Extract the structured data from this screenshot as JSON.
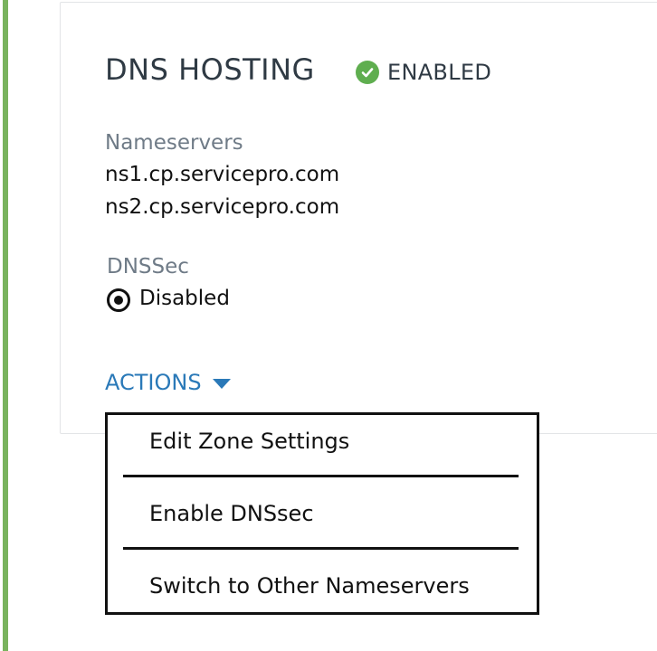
{
  "card": {
    "title": "DNS HOSTING",
    "status": {
      "label": "ENABLED",
      "icon": "check-circle-icon",
      "color": "#5fae4f"
    }
  },
  "nameservers": {
    "label": "Nameservers",
    "values": [
      "ns1.cp.servicepro.com",
      "ns2.cp.servicepro.com"
    ]
  },
  "dnssec": {
    "label": "DNSSec",
    "value": "Disabled",
    "icon": "radio-selected-icon"
  },
  "actions": {
    "label": "ACTIONS",
    "icon": "caret-down-icon",
    "color": "#2a79b8",
    "menu": [
      "Edit Zone Settings",
      "Enable DNSsec",
      "Switch to Other Nameservers"
    ]
  },
  "accent_color": "#79b35e"
}
